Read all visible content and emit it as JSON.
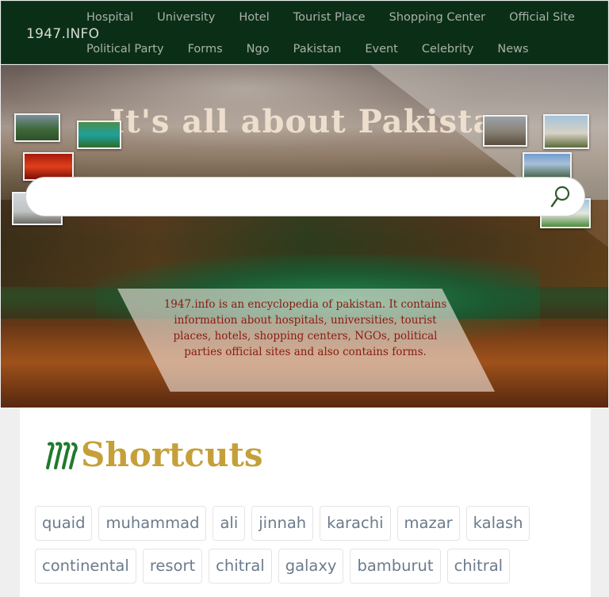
{
  "navbar": {
    "brand": "1947.INFO",
    "row1": [
      "Hospital",
      "University",
      "Hotel",
      "Tourist Place",
      "Shopping Center",
      "Official Site"
    ],
    "row2": [
      "Political Party",
      "Forms",
      "Ngo",
      "Pakistan",
      "Event",
      "Celebrity",
      "News"
    ]
  },
  "hero": {
    "title": "It's all about Pakistan",
    "search": {
      "placeholder": "",
      "value": ""
    },
    "about": "1947.info is an encyclopedia of pakistan. It contains information about hospitals, universities, tourist places, hotels, shopping centers, NGOs, political parties official sites and also contains forms."
  },
  "shortcuts": {
    "title": "Shortcuts",
    "row1": [
      "quaid",
      "muhammad",
      "ali",
      "jinnah",
      "karachi",
      "mazar",
      "kalash"
    ],
    "row2": [
      "continental",
      "resort",
      "chitral",
      "galaxy",
      "bamburut",
      "chitral"
    ]
  },
  "colors": {
    "navbar_bg": "#0b2f16",
    "shortcuts_title": "#c5a03a",
    "about_text": "#8a1a10",
    "tag_text": "#6b7b8c"
  }
}
